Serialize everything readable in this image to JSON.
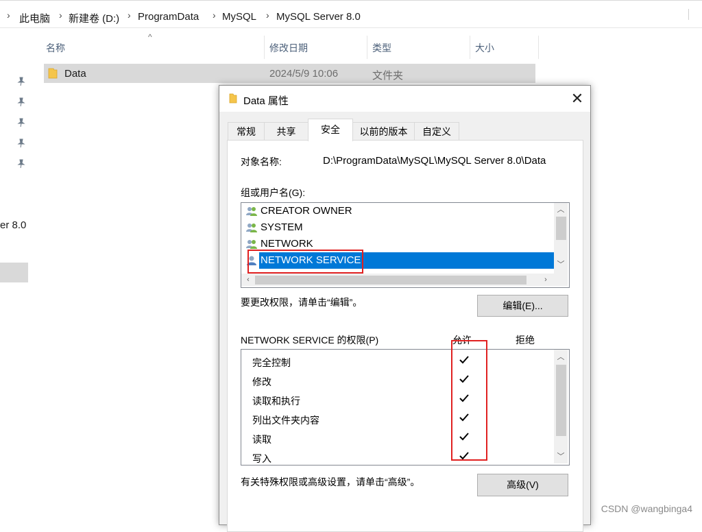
{
  "breadcrumb": {
    "items": [
      "此电脑",
      "新建卷 (D:)",
      "ProgramData",
      "MySQL",
      "MySQL Server 8.0"
    ]
  },
  "explorer": {
    "columns": {
      "name": "名称",
      "modified": "修改日期",
      "type": "类型",
      "size": "大小"
    },
    "rows": [
      {
        "name": "Data",
        "modified": "2024/5/9 10:06",
        "type": "文件夹",
        "size": ""
      }
    ],
    "nav_partial_label": "er 8.0"
  },
  "dialog": {
    "title": "Data 属性",
    "close_glyph": "✕",
    "tabs": [
      "常规",
      "共享",
      "安全",
      "以前的版本",
      "自定义"
    ],
    "active_tab": "安全",
    "object_name_label": "对象名称:",
    "object_name_value": "D:\\ProgramData\\MySQL\\MySQL Server 8.0\\Data",
    "group_label": "组或用户名(G):",
    "users": [
      {
        "name": "CREATOR OWNER",
        "icon": "users-group-icon"
      },
      {
        "name": "SYSTEM",
        "icon": "users-group-icon"
      },
      {
        "name": "NETWORK",
        "icon": "users-group-icon"
      },
      {
        "name": "NETWORK SERVICE",
        "icon": "user-icon",
        "selected": true
      }
    ],
    "edit_hint": "要更改权限，请单击“编辑”。",
    "edit_button": "编辑(E)...",
    "perm_title": "NETWORK SERVICE 的权限(P)",
    "allow_header": "允许",
    "deny_header": "拒绝",
    "permissions": [
      {
        "name": "完全控制",
        "allow": true,
        "deny": false
      },
      {
        "name": "修改",
        "allow": true,
        "deny": false
      },
      {
        "name": "读取和执行",
        "allow": true,
        "deny": false
      },
      {
        "name": "列出文件夹内容",
        "allow": true,
        "deny": false
      },
      {
        "name": "读取",
        "allow": true,
        "deny": false
      },
      {
        "name": "写入",
        "allow": true,
        "deny": false
      }
    ],
    "advanced_hint": "有关特殊权限或高级设置，请单击“高级”。",
    "advanced_button": "高级(V)"
  },
  "watermark": "CSDN @wangbinga4",
  "colors": {
    "selection": "#0078d7",
    "annotation": "#e02020",
    "folder": "#f5c54b"
  }
}
